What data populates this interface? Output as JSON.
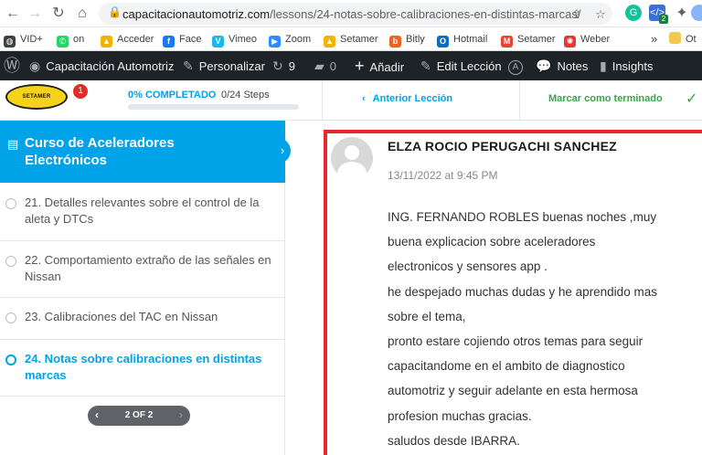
{
  "browser": {
    "url_domain": "capacitacionautomotriz.com",
    "url_path": "/lessons/24-notas-sobre-calibraciones-en-distintas-marcas/",
    "ext_badge": "2"
  },
  "bookmarks": [
    {
      "label": "VID+",
      "icon": "globe-icon",
      "color": "#3c4043"
    },
    {
      "label": "on",
      "icon": "whatsapp-icon",
      "color": "#25d366"
    },
    {
      "label": "Acceder",
      "icon": "triangle-icon",
      "color": "#f0b400"
    },
    {
      "label": "Face",
      "icon": "facebook-icon",
      "color": "#1877f2"
    },
    {
      "label": "Vimeo",
      "icon": "vimeo-icon",
      "color": "#1ab7ea"
    },
    {
      "label": "Zoom",
      "icon": "zoom-icon",
      "color": "#2d8cff"
    },
    {
      "label": "Setamer",
      "icon": "drive-icon",
      "color": "#f4b400"
    },
    {
      "label": "Bitly",
      "icon": "bitly-icon",
      "color": "#ee6123"
    },
    {
      "label": "Hotmail",
      "icon": "outlook-icon",
      "color": "#0f6cbd"
    },
    {
      "label": "Setamer",
      "icon": "gmail-icon",
      "color": "#ea4335"
    },
    {
      "label": "Weber",
      "icon": "weber-icon",
      "color": "#e53935"
    }
  ],
  "bookmarks_more": "»",
  "bookmarks_other": "Ot",
  "wpbar": {
    "site": "Capacitación Automotriz",
    "customize": "Personalizar",
    "updates": "9",
    "comments": "0",
    "new": "Añadir",
    "edit": "Edit Lección",
    "notes": "Notes",
    "insights": "Insights"
  },
  "course_header": {
    "logo_text": "SETAMER",
    "badge": "1",
    "percent_label": "0% COMPLETADO",
    "progress": 0,
    "steps": "0/24 Steps",
    "prev": "Anterior Lección",
    "mark_complete": "Marcar como terminado"
  },
  "sidebar": {
    "course_title": "Curso de Aceleradores Electrónicos",
    "lessons": [
      {
        "title": "21. Detalles relevantes sobre el control de la aleta y DTCs",
        "active": false
      },
      {
        "title": "22. Comportamiento extraño de las señales en Nissan",
        "active": false
      },
      {
        "title": "23. Calibraciones del TAC en Nissan",
        "active": false
      },
      {
        "title": "24. Notas sobre calibraciones en distintas marcas",
        "active": true
      }
    ],
    "pager": "2 OF 2"
  },
  "comment": {
    "author": "ELZA ROCIO PERUGACHI SANCHEZ",
    "date": "13/11/2022 at 9:45 PM",
    "lines": [
      "ING. FERNANDO ROBLES buenas noches ,muy",
      "buena explicacion sobre aceleradores",
      "electronicos y sensores app .",
      "he despejado muchas dudas y he aprendido mas",
      "sobre el tema,",
      "pronto estare cojiendo otros temas para seguir",
      "capacitandome en el ambito de diagnostico",
      "automotriz y seguir adelante en esta hermosa",
      "profesion muchas gracias.",
      "saludos desde IBARRA."
    ]
  }
}
